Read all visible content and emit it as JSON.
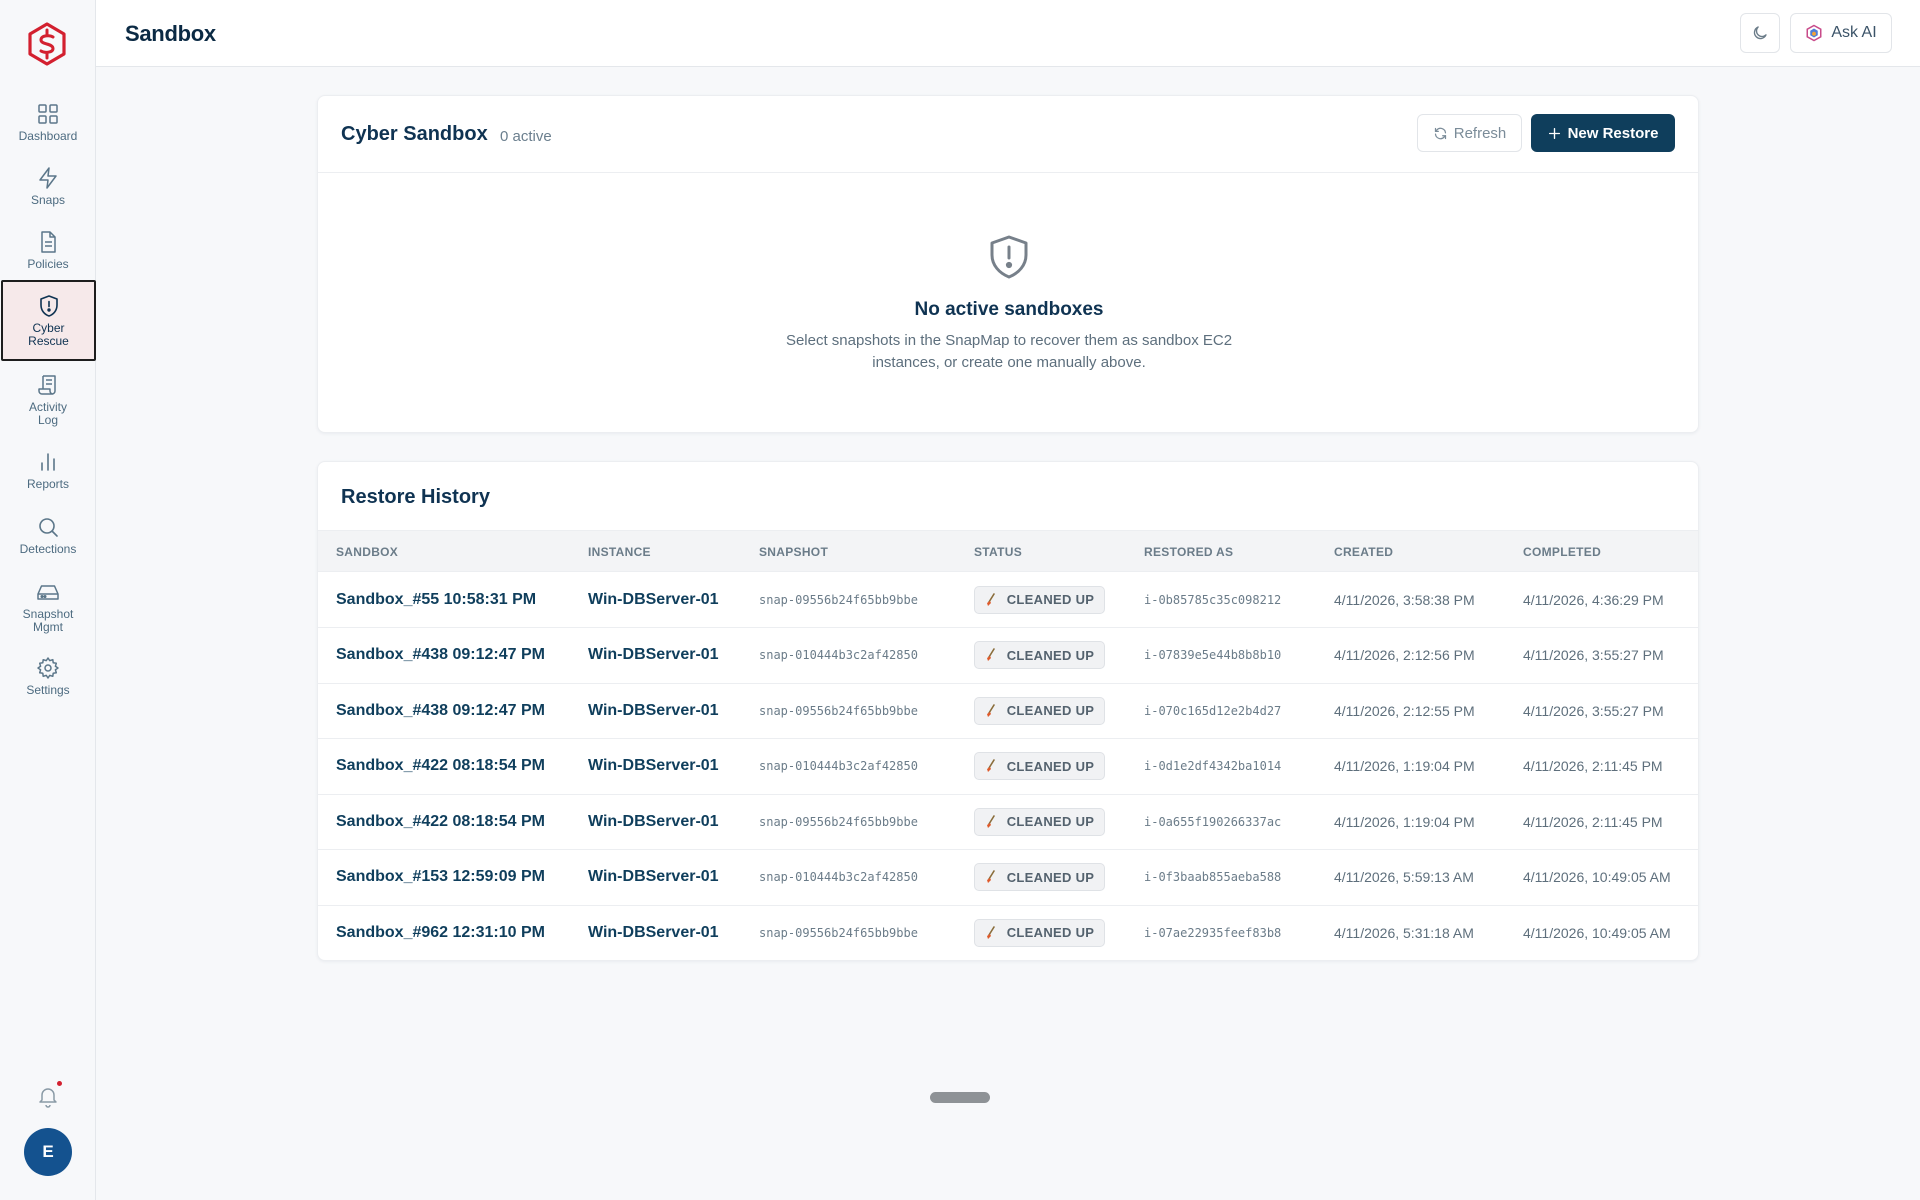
{
  "header": {
    "title": "Sandbox",
    "ask_ai_label": "Ask AI",
    "theme_toggle_icon": "moon-icon"
  },
  "sidebar": {
    "items": [
      {
        "label": "Dashboard",
        "icon": "dashboard-icon"
      },
      {
        "label": "Snaps",
        "icon": "bolt-icon"
      },
      {
        "label": "Policies",
        "icon": "document-icon"
      },
      {
        "label_line1": "Cyber",
        "label_line2": "Rescue",
        "icon": "shield-alert-icon",
        "active": true
      },
      {
        "label_line1": "Activity",
        "label_line2": "Log",
        "icon": "scroll-icon"
      },
      {
        "label": "Reports",
        "icon": "bar-chart-icon"
      },
      {
        "label": "Detections",
        "icon": "search-icon"
      },
      {
        "label_line1": "Snapshot",
        "label_line2": "Mgmt",
        "icon": "drive-icon"
      },
      {
        "label": "Settings",
        "icon": "gear-icon"
      }
    ],
    "avatar_initial": "E"
  },
  "sandbox_card": {
    "title": "Cyber Sandbox",
    "active_count": "0 active",
    "refresh_label": "Refresh",
    "new_restore_label": "New Restore",
    "empty_title": "No active sandboxes",
    "empty_description": "Select snapshots in the SnapMap to recover them as sandbox EC2 instances, or create one manually above."
  },
  "history": {
    "title": "Restore History",
    "columns": [
      "SANDBOX",
      "INSTANCE",
      "SNAPSHOT",
      "STATUS",
      "RESTORED AS",
      "CREATED",
      "COMPLETED"
    ],
    "rows": [
      {
        "sandbox": "Sandbox_#55 10:58:31 PM",
        "instance": "Win-DBServer-01",
        "snapshot": "snap-09556b24f65bb9bbe",
        "status": "CLEANED UP",
        "restored_as": "i-0b85785c35c098212",
        "created": "4/11/2026, 3:58:38 PM",
        "completed": "4/11/2026, 4:36:29 PM"
      },
      {
        "sandbox": "Sandbox_#438 09:12:47 PM",
        "instance": "Win-DBServer-01",
        "snapshot": "snap-010444b3c2af42850",
        "status": "CLEANED UP",
        "restored_as": "i-07839e5e44b8b8b10",
        "created": "4/11/2026, 2:12:56 PM",
        "completed": "4/11/2026, 3:55:27 PM"
      },
      {
        "sandbox": "Sandbox_#438 09:12:47 PM",
        "instance": "Win-DBServer-01",
        "snapshot": "snap-09556b24f65bb9bbe",
        "status": "CLEANED UP",
        "restored_as": "i-070c165d12e2b4d27",
        "created": "4/11/2026, 2:12:55 PM",
        "completed": "4/11/2026, 3:55:27 PM"
      },
      {
        "sandbox": "Sandbox_#422 08:18:54 PM",
        "instance": "Win-DBServer-01",
        "snapshot": "snap-010444b3c2af42850",
        "status": "CLEANED UP",
        "restored_as": "i-0d1e2df4342ba1014",
        "created": "4/11/2026, 1:19:04 PM",
        "completed": "4/11/2026, 2:11:45 PM"
      },
      {
        "sandbox": "Sandbox_#422 08:18:54 PM",
        "instance": "Win-DBServer-01",
        "snapshot": "snap-09556b24f65bb9bbe",
        "status": "CLEANED UP",
        "restored_as": "i-0a655f190266337ac",
        "created": "4/11/2026, 1:19:04 PM",
        "completed": "4/11/2026, 2:11:45 PM"
      },
      {
        "sandbox": "Sandbox_#153 12:59:09 PM",
        "instance": "Win-DBServer-01",
        "snapshot": "snap-010444b3c2af42850",
        "status": "CLEANED UP",
        "restored_as": "i-0f3baab855aeba588",
        "created": "4/11/2026, 5:59:13 AM",
        "completed": "4/11/2026, 10:49:05 AM"
      },
      {
        "sandbox": "Sandbox_#962 12:31:10 PM",
        "instance": "Win-DBServer-01",
        "snapshot": "snap-09556b24f65bb9bbe",
        "status": "CLEANED UP",
        "restored_as": "i-07ae22935feef83b8",
        "created": "4/11/2026, 5:31:18 AM",
        "completed": "4/11/2026, 10:49:05 AM"
      }
    ]
  },
  "colors": {
    "brand_red": "#d3202f",
    "primary_navy": "#0f3e5c",
    "active_nav_bg": "#f6e9ea"
  }
}
